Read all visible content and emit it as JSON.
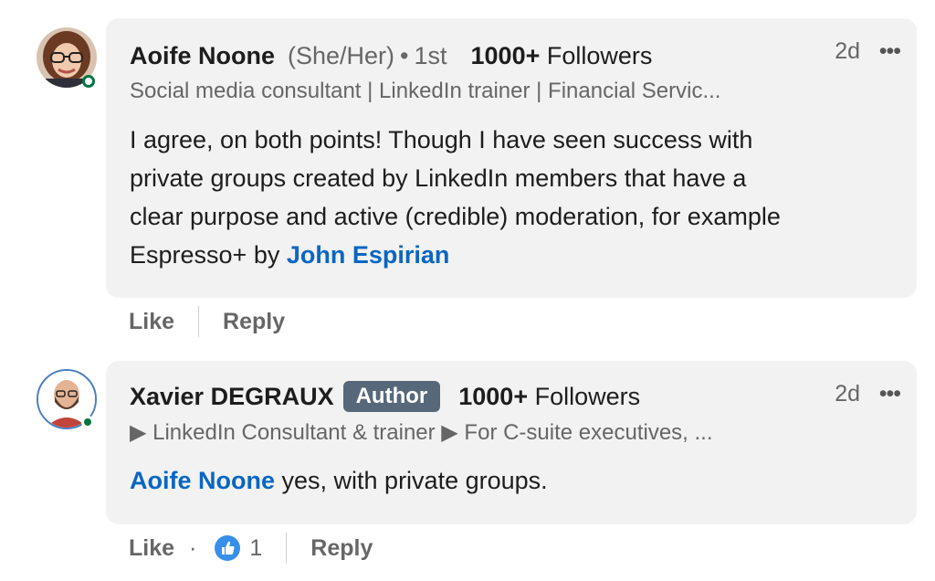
{
  "comments": [
    {
      "author": "Aoife Noone",
      "pronouns": "(She/Her)",
      "degree_sep": "•",
      "degree": "1st",
      "followers_count": "1000+",
      "followers_label": "Followers",
      "headline": "Social media consultant | LinkedIn trainer | Financial Servic...",
      "time": "2d",
      "more": "•••",
      "body_lines": [
        "I agree, on both points! Though I have seen success with",
        "private groups created by LinkedIn members that have a",
        "clear purpose and active (credible) moderation, for example",
        "Espresso+ by"
      ],
      "mention": "John Espirian",
      "actions": {
        "like": "Like",
        "reply": "Reply"
      },
      "presence_color": "#057642",
      "avatar_icon": "woman-with-glasses-avatar"
    },
    {
      "author": "Xavier DEGRAUX",
      "badge": "Author",
      "followers_count": "1000+",
      "followers_label": "Followers",
      "headline": "▶ LinkedIn Consultant & trainer ▶ For C-suite executives, ...",
      "time": "2d",
      "more": "•••",
      "mention": "Aoife Noone",
      "body": "yes, with private groups.",
      "actions": {
        "like": "Like",
        "dot": "·",
        "reaction_count": "1",
        "reply": "Reply"
      },
      "presence_color": "#057642",
      "avatar_icon": "bearded-man-avatar",
      "reaction_icon": "thumbs-up-icon"
    }
  ],
  "colors": {
    "link": "#0a66c2",
    "bubble": "#f2f2f2",
    "badge": "#56687a",
    "reaction": "#378fe9"
  }
}
